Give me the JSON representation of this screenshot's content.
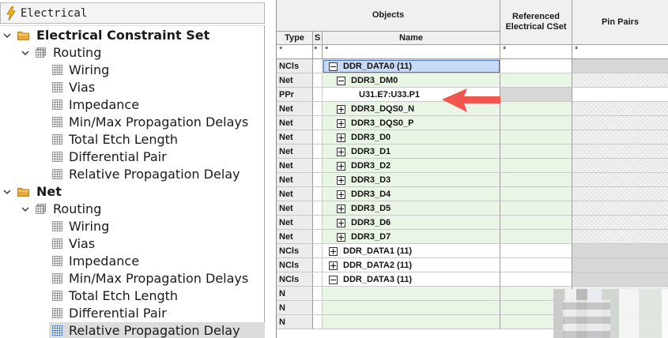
{
  "workbook": {
    "title": "Electrical"
  },
  "tree": [
    {
      "level": 0,
      "kind": "folder",
      "label": "Electrical Constraint Set",
      "expanded": true
    },
    {
      "level": 1,
      "kind": "grid",
      "label": "Routing",
      "expanded": true
    },
    {
      "level": 2,
      "kind": "sheet",
      "label": "Wiring"
    },
    {
      "level": 2,
      "kind": "sheet",
      "label": "Vias"
    },
    {
      "level": 2,
      "kind": "sheet",
      "label": "Impedance"
    },
    {
      "level": 2,
      "kind": "sheet",
      "label": "Min/Max Propagation Delays"
    },
    {
      "level": 2,
      "kind": "sheet",
      "label": "Total Etch Length"
    },
    {
      "level": 2,
      "kind": "sheet",
      "label": "Differential Pair"
    },
    {
      "level": 2,
      "kind": "sheet",
      "label": "Relative Propagation Delay"
    },
    {
      "level": 0,
      "kind": "folder",
      "label": "Net",
      "expanded": true
    },
    {
      "level": 1,
      "kind": "grid",
      "label": "Routing",
      "expanded": true
    },
    {
      "level": 2,
      "kind": "sheet",
      "label": "Wiring"
    },
    {
      "level": 2,
      "kind": "sheet",
      "label": "Vias"
    },
    {
      "level": 2,
      "kind": "sheet",
      "label": "Impedance"
    },
    {
      "level": 2,
      "kind": "sheet",
      "label": "Min/Max Propagation Delays"
    },
    {
      "level": 2,
      "kind": "sheet",
      "label": "Total Etch Length"
    },
    {
      "level": 2,
      "kind": "sheet",
      "label": "Differential Pair"
    },
    {
      "level": 2,
      "kind": "sheet",
      "label": "Relative Propagation Delay",
      "selected": true
    }
  ],
  "grid": {
    "headers": {
      "objects": "Objects",
      "type": "Type",
      "s": "S",
      "name": "Name",
      "referenced": "Referenced Electrical CSet",
      "pin_pairs": "Pin Pairs"
    },
    "filter": {
      "type": "*",
      "s": "*",
      "name": "*",
      "referenced": "*",
      "pin_pairs": "*"
    },
    "rows": [
      {
        "type": "NCls",
        "indent": 0,
        "toggle": "minus",
        "name": "DDR_DATA0 (11)",
        "style": "selected"
      },
      {
        "type": "Net",
        "indent": 1,
        "toggle": "minus",
        "name": "DDR3_DM0",
        "style": "net"
      },
      {
        "type": "PPr",
        "indent": 2,
        "toggle": "",
        "name": "U31.E7:U33.P1",
        "style": "ppr"
      },
      {
        "type": "Net",
        "indent": 1,
        "toggle": "plus",
        "name": "DDR3_DQS0_N",
        "style": "net"
      },
      {
        "type": "Net",
        "indent": 1,
        "toggle": "plus",
        "name": "DDR3_DQS0_P",
        "style": "net"
      },
      {
        "type": "Net",
        "indent": 1,
        "toggle": "plus",
        "name": "DDR3_D0",
        "style": "net"
      },
      {
        "type": "Net",
        "indent": 1,
        "toggle": "plus",
        "name": "DDR3_D1",
        "style": "net"
      },
      {
        "type": "Net",
        "indent": 1,
        "toggle": "plus",
        "name": "DDR3_D2",
        "style": "net"
      },
      {
        "type": "Net",
        "indent": 1,
        "toggle": "plus",
        "name": "DDR3_D3",
        "style": "net"
      },
      {
        "type": "Net",
        "indent": 1,
        "toggle": "plus",
        "name": "DDR3_D4",
        "style": "net"
      },
      {
        "type": "Net",
        "indent": 1,
        "toggle": "plus",
        "name": "DDR3_D5",
        "style": "net"
      },
      {
        "type": "Net",
        "indent": 1,
        "toggle": "plus",
        "name": "DDR3_D6",
        "style": "net"
      },
      {
        "type": "Net",
        "indent": 1,
        "toggle": "plus",
        "name": "DDR3_D7",
        "style": "net"
      },
      {
        "type": "NCls",
        "indent": 0,
        "toggle": "plus",
        "name": "DDR_DATA1 (11)",
        "style": "ncls"
      },
      {
        "type": "NCls",
        "indent": 0,
        "toggle": "plus",
        "name": "DDR_DATA2 (11)",
        "style": "ncls"
      },
      {
        "type": "NCls",
        "indent": 0,
        "toggle": "minus",
        "name": "DDR_DATA3 (11)",
        "style": "ncls"
      },
      {
        "type": "N",
        "indent": 1,
        "toggle": "",
        "name": "",
        "style": "net"
      },
      {
        "type": "N",
        "indent": 1,
        "toggle": "",
        "name": "",
        "style": "net"
      },
      {
        "type": "N",
        "indent": 1,
        "toggle": "",
        "name": "",
        "style": "net"
      }
    ]
  },
  "colors": {
    "net_row": "#eaf6e5",
    "selected_name": "#c8daf5",
    "arrow": "#f0564e",
    "folder": "#e7a93a"
  }
}
